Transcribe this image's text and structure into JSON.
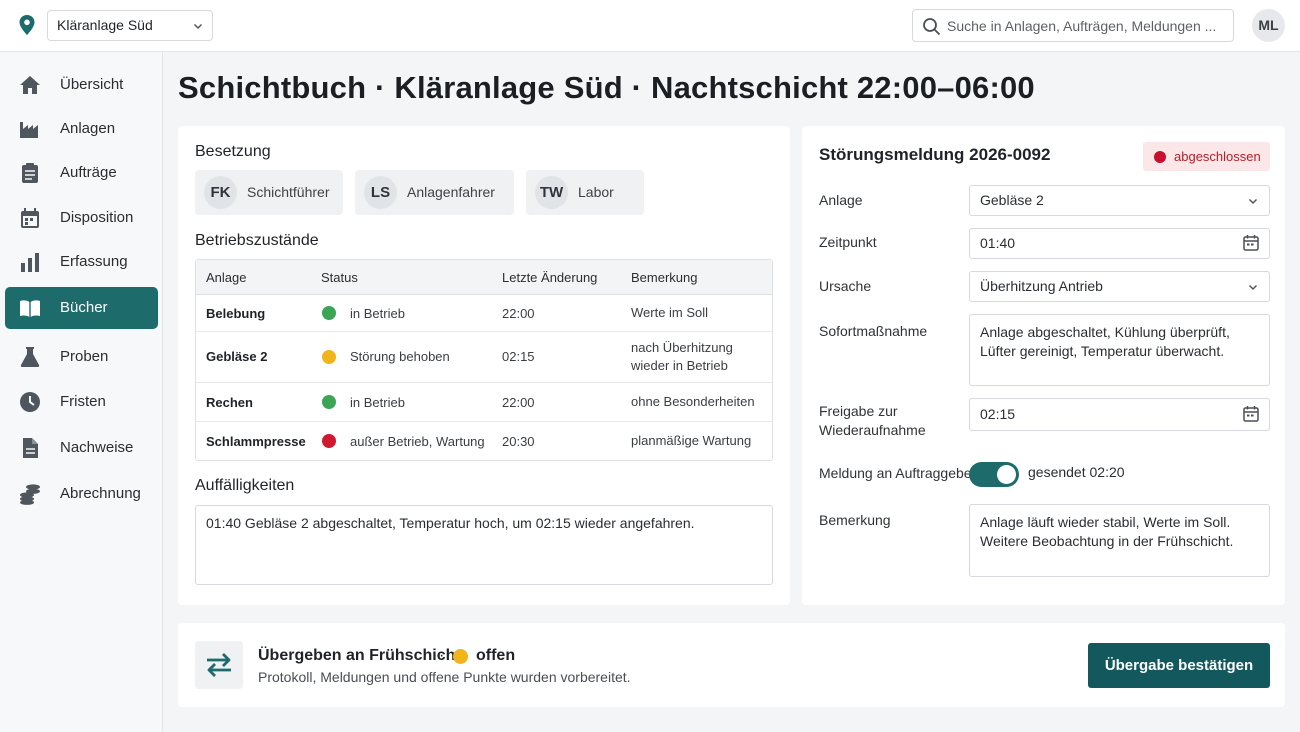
{
  "topbar": {
    "plant_select": "Kläranlage Süd",
    "search_placeholder": "Suche in Anlagen, Aufträgen, Meldungen ...",
    "avatar_initials": "ML"
  },
  "sidebar": {
    "items": [
      {
        "label": "Übersicht",
        "icon": "home-icon"
      },
      {
        "label": "Anlagen",
        "icon": "factory-icon"
      },
      {
        "label": "Aufträge",
        "icon": "clipboard-icon"
      },
      {
        "label": "Disposition",
        "icon": "calendar-icon"
      },
      {
        "label": "Erfassung",
        "icon": "bar-chart-icon"
      },
      {
        "label": "Bücher",
        "icon": "book-icon",
        "active": true
      },
      {
        "label": "Proben",
        "icon": "flask-icon"
      },
      {
        "label": "Fristen",
        "icon": "clock-icon"
      },
      {
        "label": "Nachweise",
        "icon": "document-icon"
      },
      {
        "label": "Abrechnung",
        "icon": "coins-icon"
      }
    ]
  },
  "page": {
    "title": "Schichtbuch · Kläranlage Süd · Nachtschicht 22:00–06:00"
  },
  "shift_log": {
    "crew_title": "Besetzung",
    "crew": [
      {
        "initials": "FK",
        "role": "Schichtführer"
      },
      {
        "initials": "LS",
        "role": "Anlagenfahrer"
      },
      {
        "initials": "TW",
        "role": "Labor"
      }
    ],
    "status_title": "Betriebszustände",
    "columns": [
      "Anlage",
      "Status",
      "Letzte Änderung",
      "Bemerkung"
    ],
    "rows": [
      {
        "anlage": "Belebung",
        "status": "in Betrieb",
        "status_color": "#3aa655",
        "time": "22:00",
        "remark": "Werte im Soll"
      },
      {
        "anlage": "Gebläse 2",
        "status": "Störung behoben",
        "status_color": "#f0b41c",
        "time": "02:15",
        "remark": "nach Überhitzung wieder in Betrieb"
      },
      {
        "anlage": "Rechen",
        "status": "in Betrieb",
        "status_color": "#3aa655",
        "time": "22:00",
        "remark": "ohne Besonderheiten"
      },
      {
        "anlage": "Schlammpresse",
        "status": "außer Betrieb, Wartung",
        "status_color": "#d0182f",
        "time": "20:30",
        "remark": "planmäßige Wartung"
      }
    ],
    "notes_title": "Auffälligkeiten",
    "notes": "01:40 Gebläse 2 abgeschaltet, Temperatur hoch, um 02:15 wieder angefahren."
  },
  "incident": {
    "title": "Störungsmeldung 2026-0092",
    "badge": "abgeschlossen",
    "badge_color": "#c8102e",
    "fields": {
      "anlage_label": "Anlage",
      "anlage_value": "Gebläse 2",
      "zeitpunkt_label": "Zeitpunkt",
      "zeitpunkt_value": "01:40",
      "ursache_label": "Ursache",
      "ursache_value": "Überhitzung Antrieb",
      "sofort_label": "Sofortmaßnahme",
      "sofort_value": "Anlage abgeschaltet, Kühlung überprüft, Lüfter gereinigt, Temperatur überwacht.",
      "freigabe_label": "Freigabe zur Wiederaufnahme",
      "freigabe_value": "02:15",
      "meldung_label": "Meldung an Auftraggeber",
      "meldung_value": "gesendet 02:20",
      "meldung_on": true,
      "bemerkung_label": "Bemerkung",
      "bemerkung_value": "Anlage läuft wieder stabil, Werte im Soll. Weitere Beobachtung in der Frühschicht."
    }
  },
  "handover": {
    "title": "Übergeben an Frühschicht",
    "separator": "·",
    "status": "offen",
    "status_color": "#f0b41c",
    "subtitle": "Protokoll, Meldungen und offene Punkte wurden vorbereitet.",
    "button": "Übergabe bestätigen"
  },
  "colors": {
    "accent": "#1d6b6b",
    "button": "#13585c"
  }
}
